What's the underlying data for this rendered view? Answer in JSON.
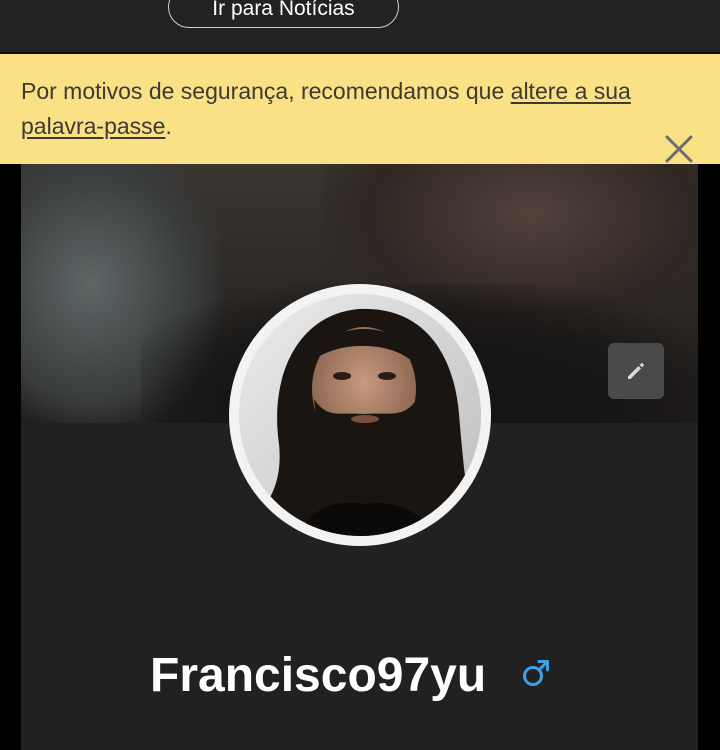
{
  "header": {
    "news_button_label": "Ir para Notícias"
  },
  "alert": {
    "text_before": "Por motivos de segurança, recomendamos que ",
    "link_text": "altere a sua palavra-passe",
    "text_after": ".",
    "background_color": "#fbe186",
    "close_icon": "close-icon"
  },
  "profile": {
    "username": "Francisco97yu",
    "gender_icon": "male-icon",
    "gender_color": "#3fa0e6",
    "edit_icon": "pencil-icon"
  }
}
